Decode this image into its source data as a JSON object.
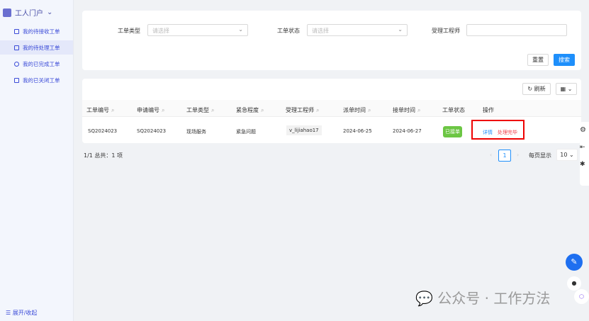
{
  "sidebar": {
    "title": "工人门户",
    "items": [
      {
        "label": "我的待接收工单"
      },
      {
        "label": "我的待处理工单"
      },
      {
        "label": "我的已完成工单"
      },
      {
        "label": "我的已关闭工单"
      }
    ],
    "toggle": "展开/收起"
  },
  "filters": {
    "type_label": "工单类型",
    "type_placeholder": "请选择",
    "status_label": "工单状态",
    "status_placeholder": "请选择",
    "engineer_label": "受理工程师",
    "engineer_value": "",
    "reset": "重置",
    "search": "搜索"
  },
  "toolbar": {
    "refresh": "刷新"
  },
  "table": {
    "headers": [
      "工单编号",
      "申请编号",
      "工单类型",
      "紧急程度",
      "受理工程师",
      "派单时间",
      "接单时间",
      "工单状态",
      "操作"
    ],
    "rows": [
      {
        "id": "SQ2024023",
        "apply": "SQ2024023",
        "type": "现场服务",
        "urgency": "紧急问题",
        "engineer": "v_lijiahao17",
        "dispatch": "2024-06-25",
        "accept": "2024-06-27",
        "status": "已接单",
        "detail": "详情",
        "finish": "处理完毕"
      }
    ]
  },
  "pagination": {
    "summary": "1/1 总共：1 项",
    "page": "1",
    "per_page_label": "每页显示",
    "per_page": "10"
  },
  "watermark": "公众号 · 工作方法"
}
